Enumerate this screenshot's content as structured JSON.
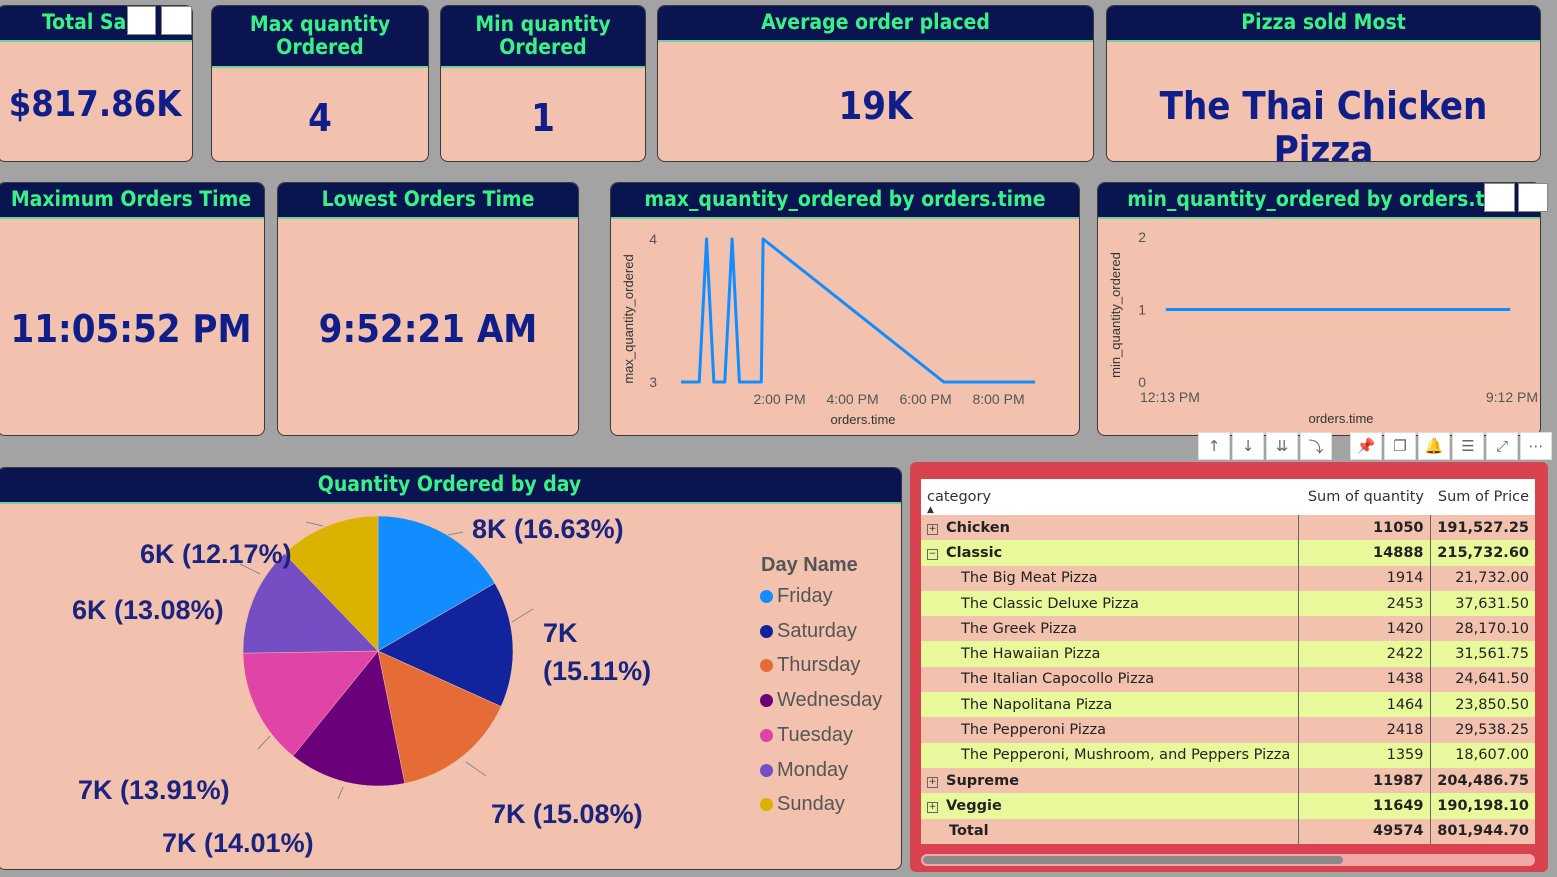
{
  "colors": {
    "header_bg": "#0a1450",
    "header_text": "#39f286",
    "card_bg": "#f2c2ae",
    "value_text": "#101e8a",
    "matrix_frame": "#d9434f",
    "row_alt": "#e8f99c"
  },
  "kpis": {
    "total_sales": {
      "title": "Total Sal",
      "value": "$817.86K"
    },
    "max_qty": {
      "title_line1": "Max quantity",
      "title_line2": "Ordered",
      "value": "4"
    },
    "min_qty": {
      "title_line1": "Min quantity",
      "title_line2": "Ordered",
      "value": "1"
    },
    "avg_order": {
      "title": "Average order placed",
      "value": "19K"
    },
    "pizza_most": {
      "title": "Pizza sold Most",
      "value": "The Thai Chicken Pizza"
    },
    "max_time": {
      "title": "Maximum Orders Time",
      "value": "11:05:52 PM"
    },
    "low_time": {
      "title": "Lowest Orders Time",
      "value": "9:52:21 AM"
    }
  },
  "chart_data": [
    {
      "type": "line",
      "title": "max_quantity_ordered by orders.time",
      "xlabel": "orders.time",
      "ylabel": "max_quantity_ordered",
      "x_ticks": [
        "2:00 PM",
        "4:00 PM",
        "6:00 PM",
        "8:00 PM"
      ],
      "y_ticks": [
        "3",
        "4"
      ],
      "ylim": [
        3,
        4
      ],
      "x_hours_range": [
        11.3,
        21.3
      ],
      "points": [
        [
          11.3,
          3
        ],
        [
          11.8,
          3
        ],
        [
          12.0,
          4
        ],
        [
          12.2,
          3
        ],
        [
          12.5,
          3
        ],
        [
          12.7,
          4
        ],
        [
          12.9,
          3
        ],
        [
          13.5,
          3
        ],
        [
          13.55,
          4
        ],
        [
          18.5,
          3
        ],
        [
          21.0,
          3
        ]
      ],
      "grid": false
    },
    {
      "type": "line",
      "title": "min_quantity_ordered by orders.tim",
      "xlabel": "orders.time",
      "ylabel": "min_quantity_ordered",
      "x_ticks": [
        "12:13 PM",
        "9:12 PM"
      ],
      "y_ticks": [
        "0",
        "1",
        "2"
      ],
      "ylim": [
        0,
        2
      ],
      "points": [
        [
          0.06,
          1
        ],
        [
          0.93,
          1
        ]
      ],
      "grid": false
    },
    {
      "type": "pie",
      "title": "Quantity Ordered by day",
      "legend_title": "Day Name",
      "legend_position": "right",
      "slices": [
        {
          "name": "Friday",
          "value": 8242,
          "pct": 16.63,
          "label": "8K (16.63%)",
          "color": "#118dff"
        },
        {
          "name": "Saturday",
          "value": 7493,
          "pct": 15.11,
          "label_line1": "7K",
          "label_line2": "(15.11%)",
          "color": "#12239e"
        },
        {
          "name": "Thursday",
          "value": 7478,
          "pct": 15.08,
          "label": "7K (15.08%)",
          "color": "#e66c37"
        },
        {
          "name": "Wednesday",
          "value": 6946,
          "pct": 14.01,
          "label": "7K (14.01%)",
          "color": "#6b007b"
        },
        {
          "name": "Tuesday",
          "value": 6895,
          "pct": 13.91,
          "label": "7K (13.91%)",
          "color": "#e044a7"
        },
        {
          "name": "Monday",
          "value": 6485,
          "pct": 13.08,
          "label": "6K (13.08%)",
          "color": "#744ec2"
        },
        {
          "name": "Sunday",
          "value": 6035,
          "pct": 12.17,
          "label": "6K (12.17%)",
          "color": "#d9b300"
        }
      ]
    }
  ],
  "toolbar": [
    "↑",
    "↓",
    "⇊",
    "⤵",
    "📌",
    "❐",
    "🔔",
    "☰",
    "⤢",
    "⋯"
  ],
  "matrix": {
    "headers": [
      "category",
      "Sum of quantity",
      "Sum of Price"
    ],
    "rows": [
      {
        "kind": "group",
        "expander": "⊞",
        "label": "Chicken",
        "qty": "11050",
        "price": "191,527.25"
      },
      {
        "kind": "group",
        "expander": "⊟",
        "label": "Classic",
        "qty": "14888",
        "price": "215,732.60"
      },
      {
        "kind": "child",
        "label": "The Big Meat Pizza",
        "qty": "1914",
        "price": "21,732.00"
      },
      {
        "kind": "child",
        "label": "The Classic Deluxe Pizza",
        "qty": "2453",
        "price": "37,631.50"
      },
      {
        "kind": "child",
        "label": "The Greek Pizza",
        "qty": "1420",
        "price": "28,170.10"
      },
      {
        "kind": "child",
        "label": "The Hawaiian Pizza",
        "qty": "2422",
        "price": "31,561.75"
      },
      {
        "kind": "child",
        "label": "The Italian Capocollo Pizza",
        "qty": "1438",
        "price": "24,641.50"
      },
      {
        "kind": "child",
        "label": "The Napolitana Pizza",
        "qty": "1464",
        "price": "23,850.50"
      },
      {
        "kind": "child",
        "label": "The Pepperoni Pizza",
        "qty": "2418",
        "price": "29,538.25"
      },
      {
        "kind": "child",
        "label": "The Pepperoni, Mushroom, and Peppers Pizza",
        "qty": "1359",
        "price": "18,607.00"
      },
      {
        "kind": "group",
        "expander": "⊞",
        "label": "Supreme",
        "qty": "11987",
        "price": "204,486.75"
      },
      {
        "kind": "group",
        "expander": "⊞",
        "label": "Veggie",
        "qty": "11649",
        "price": "190,198.10"
      },
      {
        "kind": "total",
        "label": "Total",
        "qty": "49574",
        "price": "801,944.70"
      }
    ]
  }
}
